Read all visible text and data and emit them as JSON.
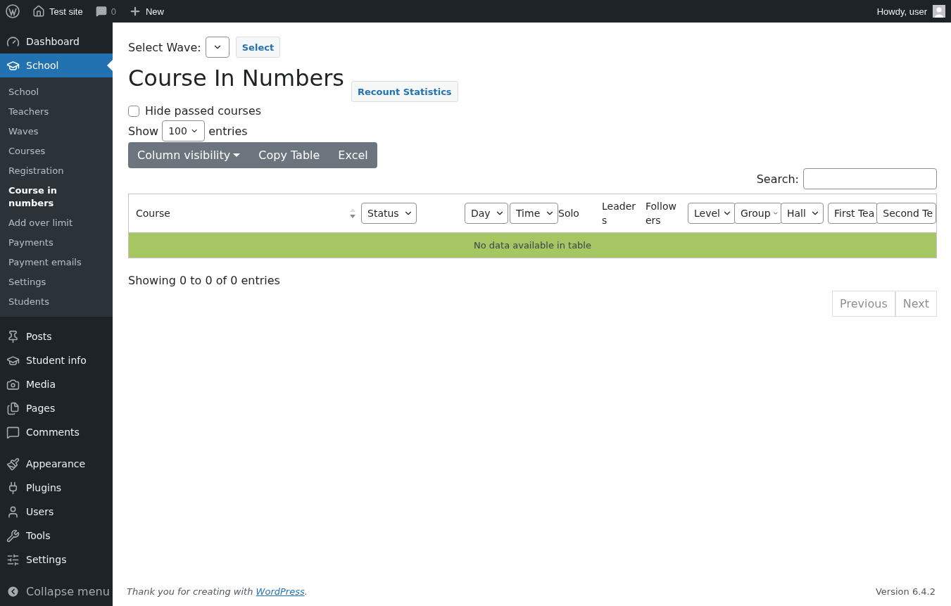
{
  "admin_bar": {
    "site": "Test site",
    "comments": "0",
    "new": "New",
    "greeting": "Howdy, user"
  },
  "sidebar": {
    "groups": [
      [
        {
          "label": "Dashboard",
          "selected": false
        }
      ],
      [
        {
          "label": "School",
          "selected": true,
          "children": [
            {
              "label": "School",
              "selected": false
            },
            {
              "label": "Teachers",
              "selected": false
            },
            {
              "label": "Waves",
              "selected": false
            },
            {
              "label": "Courses",
              "selected": false
            },
            {
              "label": "Registration",
              "selected": false
            },
            {
              "label": "Course in numbers",
              "selected": true
            },
            {
              "label": "Add over limit",
              "selected": false
            },
            {
              "label": "Payments",
              "selected": false
            },
            {
              "label": "Payment emails",
              "selected": false
            },
            {
              "label": "Settings",
              "selected": false
            },
            {
              "label": "Students",
              "selected": false
            }
          ]
        }
      ],
      [
        {
          "label": "Posts",
          "selected": false
        },
        {
          "label": "Student info",
          "selected": false
        },
        {
          "label": "Media",
          "selected": false
        },
        {
          "label": "Pages",
          "selected": false
        },
        {
          "label": "Comments",
          "selected": false
        }
      ],
      [
        {
          "label": "Appearance",
          "selected": false
        },
        {
          "label": "Plugins",
          "selected": false
        },
        {
          "label": "Users",
          "selected": false
        },
        {
          "label": "Tools",
          "selected": false
        },
        {
          "label": "Settings",
          "selected": false
        }
      ]
    ],
    "collapse": "Collapse menu"
  },
  "wave": {
    "label": "Select Wave:",
    "button": "Select"
  },
  "title": "Course In Numbers",
  "recount_button": "Recount Statistics",
  "hide_passed": {
    "label": "Hide passed courses",
    "checked": false
  },
  "length": {
    "before": "Show",
    "value": "100",
    "after": "entries"
  },
  "buttons": [
    {
      "label": "Column visibility",
      "kind": "dropdown"
    },
    {
      "label": "Copy Table",
      "kind": "plain"
    },
    {
      "label": "Excel",
      "kind": "plain"
    }
  ],
  "search": {
    "label": "Search:"
  },
  "table": {
    "columns": [
      {
        "label": "Course",
        "kind": "sort"
      },
      {
        "label": "Status",
        "kind": "select"
      },
      {
        "kind": "spacer"
      },
      {
        "label": "Day",
        "kind": "select"
      },
      {
        "label": "Time",
        "kind": "select"
      },
      {
        "label": "Solo",
        "kind": "text"
      },
      {
        "label": "Leaders",
        "kind": "text"
      },
      {
        "label": "Followers",
        "kind": "text"
      },
      {
        "label": "Level",
        "kind": "select"
      },
      {
        "label": "Group",
        "kind": "select"
      },
      {
        "label": "Hall",
        "kind": "select"
      },
      {
        "label": "First Tea",
        "kind": "cut"
      },
      {
        "label": "Second Te",
        "kind": "cut"
      }
    ],
    "empty": "No data available in table"
  },
  "info": "Showing 0 to 0 of 0 entries",
  "pagination": [
    {
      "label": "Previous",
      "disabled": true
    },
    {
      "label": "Next",
      "disabled": true
    }
  ],
  "footer": {
    "thanks": "Thank you for creating with",
    "link": "WordPress",
    "end": ".",
    "version": "Version 6.4.2"
  }
}
